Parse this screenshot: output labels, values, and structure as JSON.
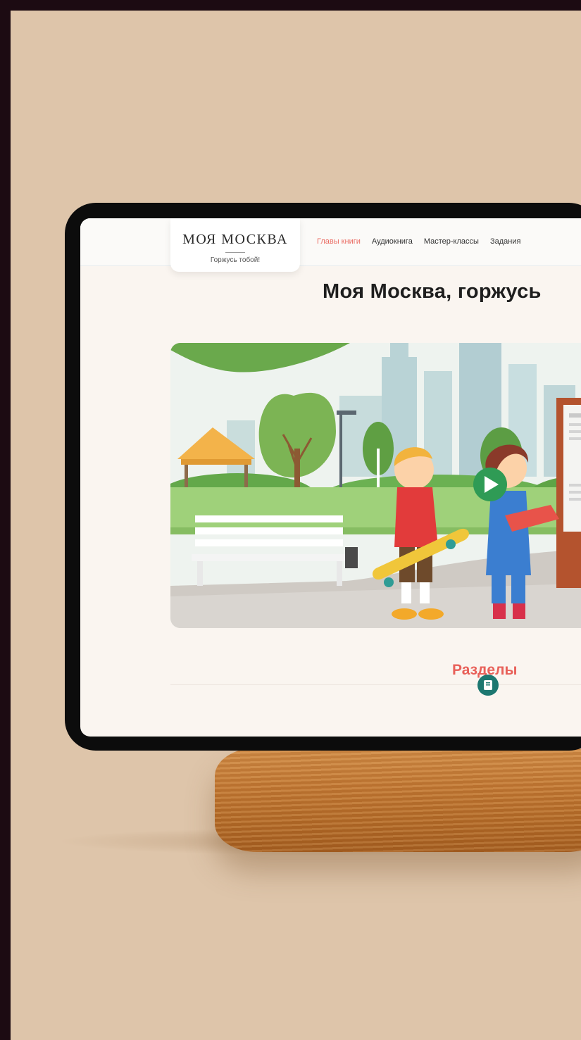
{
  "logo": {
    "title": "МОЯ МОСКВА",
    "subtitle": "Горжусь тобой!"
  },
  "nav": {
    "items": [
      {
        "label": "Главы книги",
        "active": true
      },
      {
        "label": "Аудиокнига"
      },
      {
        "label": "Мастер-классы"
      },
      {
        "label": "Задания"
      }
    ]
  },
  "hero": {
    "title": "Моя Москва, горжусь"
  },
  "sections": {
    "title": "Разделы",
    "icon": "book-icon"
  },
  "colors": {
    "accent": "#ea6b62",
    "teal": "#1c7770",
    "background": "#dec5aa",
    "play": "#2f9b55"
  }
}
